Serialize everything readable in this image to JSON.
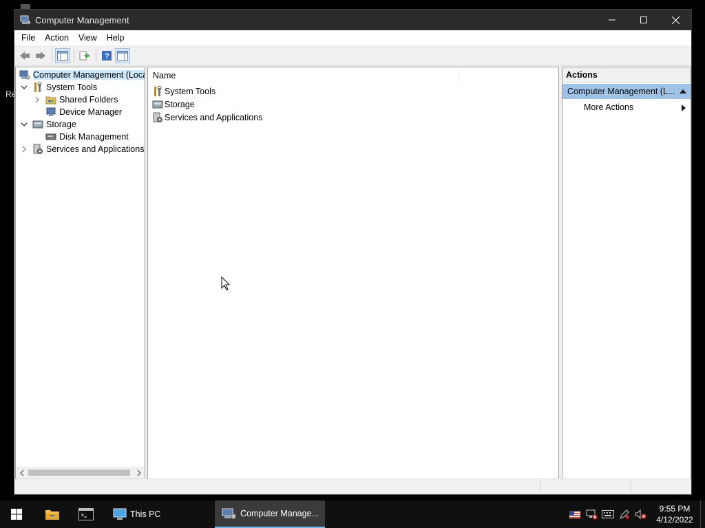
{
  "desktop": {
    "fragment_label": "Re"
  },
  "window": {
    "title": "Computer Management",
    "menu": [
      "File",
      "Action",
      "View",
      "Help"
    ],
    "tree": {
      "root": "Computer Management (Local",
      "system_tools": "System Tools",
      "shared_folders": "Shared Folders",
      "device_manager": "Device Manager",
      "storage": "Storage",
      "disk_management": "Disk Management",
      "services": "Services and Applications"
    },
    "list": {
      "column_name": "Name",
      "items": [
        "System Tools",
        "Storage",
        "Services and Applications"
      ]
    },
    "actions": {
      "header": "Actions",
      "section": "Computer Management (L...",
      "more_actions": "More Actions"
    }
  },
  "taskbar": {
    "this_pc": "This PC",
    "computer_management": "Computer Manage...",
    "time": "9:55 PM",
    "date": "4/12/2022"
  },
  "colors": {
    "selection": "#cce8ff",
    "actions_section": "#9ec3e6",
    "taskbar": "#101010",
    "titlebar": "#2b2b2b",
    "active_task_underline": "#76b9ed"
  }
}
